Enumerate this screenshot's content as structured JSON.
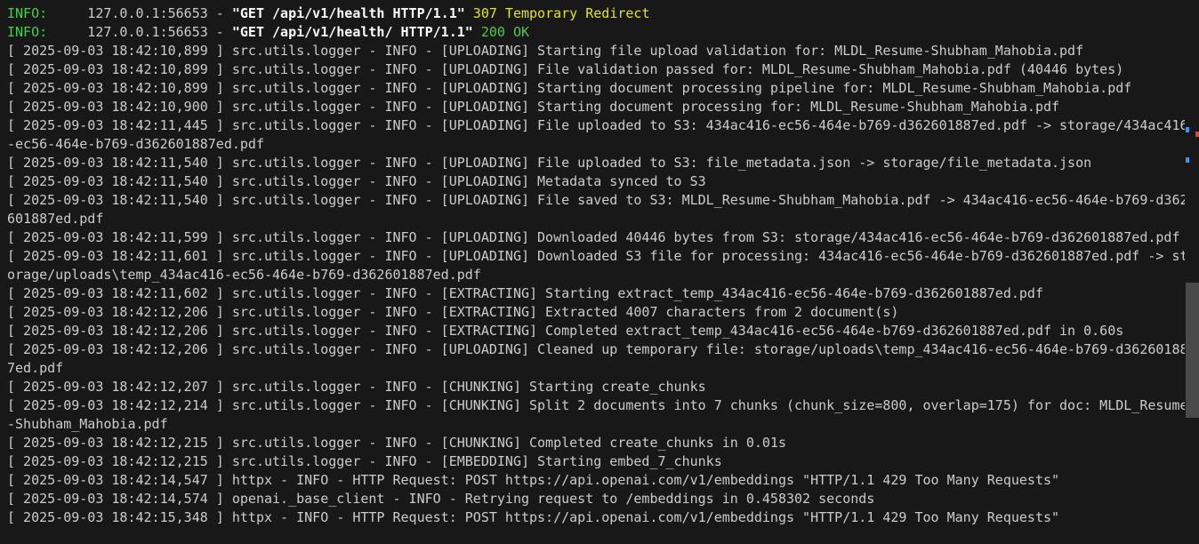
{
  "colors": {
    "background": "#181818",
    "text": "#cccccc",
    "info_green": "#4ec94e",
    "redirect_yellow": "#e5e510",
    "scrollbar_thumb": "#4a4a4a"
  },
  "terminal": {
    "access_lines": [
      {
        "level": "INFO:",
        "client": "     127.0.0.1:56653 - ",
        "request": "\"GET /api/v1/health HTTP/1.1\"",
        "status": " 307 Temporary Redirect"
      },
      {
        "level": "INFO:",
        "client": "     127.0.0.1:56653 - ",
        "request": "\"GET /api/v1/health/ HTTP/1.1\"",
        "status": " 200 OK"
      }
    ],
    "log_lines": [
      "[ 2025-09-03 18:42:10,899 ] src.utils.logger - INFO - [UPLOADING] Starting file upload validation for: MLDL_Resume-Shubham_Mahobia.pdf",
      "[ 2025-09-03 18:42:10,899 ] src.utils.logger - INFO - [UPLOADING] File validation passed for: MLDL_Resume-Shubham_Mahobia.pdf (40446 bytes)",
      "[ 2025-09-03 18:42:10,899 ] src.utils.logger - INFO - [UPLOADING] Starting document processing pipeline for: MLDL_Resume-Shubham_Mahobia.pdf",
      "[ 2025-09-03 18:42:10,900 ] src.utils.logger - INFO - [UPLOADING] Starting document processing for: MLDL_Resume-Shubham_Mahobia.pdf",
      "[ 2025-09-03 18:42:11,445 ] src.utils.logger - INFO - [UPLOADING] File uploaded to S3: 434ac416-ec56-464e-b769-d362601887ed.pdf -> storage/434ac416",
      "-ec56-464e-b769-d362601887ed.pdf",
      "[ 2025-09-03 18:42:11,540 ] src.utils.logger - INFO - [UPLOADING] File uploaded to S3: file_metadata.json -> storage/file_metadata.json",
      "[ 2025-09-03 18:42:11,540 ] src.utils.logger - INFO - [UPLOADING] Metadata synced to S3",
      "[ 2025-09-03 18:42:11,540 ] src.utils.logger - INFO - [UPLOADING] File saved to S3: MLDL_Resume-Shubham_Mahobia.pdf -> 434ac416-ec56-464e-b769-d362",
      "601887ed.pdf",
      "[ 2025-09-03 18:42:11,599 ] src.utils.logger - INFO - [UPLOADING] Downloaded 40446 bytes from S3: storage/434ac416-ec56-464e-b769-d362601887ed.pdf",
      "[ 2025-09-03 18:42:11,601 ] src.utils.logger - INFO - [UPLOADING] Downloaded S3 file for processing: 434ac416-ec56-464e-b769-d362601887ed.pdf -> st",
      "orage/uploads\\temp_434ac416-ec56-464e-b769-d362601887ed.pdf",
      "[ 2025-09-03 18:42:11,602 ] src.utils.logger - INFO - [EXTRACTING] Starting extract_temp_434ac416-ec56-464e-b769-d362601887ed.pdf",
      "[ 2025-09-03 18:42:12,206 ] src.utils.logger - INFO - [EXTRACTING] Extracted 4007 characters from 2 document(s)",
      "[ 2025-09-03 18:42:12,206 ] src.utils.logger - INFO - [EXTRACTING] Completed extract_temp_434ac416-ec56-464e-b769-d362601887ed.pdf in 0.60s",
      "[ 2025-09-03 18:42:12,206 ] src.utils.logger - INFO - [UPLOADING] Cleaned up temporary file: storage/uploads\\temp_434ac416-ec56-464e-b769-d36260188",
      "7ed.pdf",
      "[ 2025-09-03 18:42:12,207 ] src.utils.logger - INFO - [CHUNKING] Starting create_chunks",
      "[ 2025-09-03 18:42:12,214 ] src.utils.logger - INFO - [CHUNKING] Split 2 documents into 7 chunks (chunk_size=800, overlap=175) for doc: MLDL_Resume",
      "-Shubham_Mahobia.pdf",
      "[ 2025-09-03 18:42:12,215 ] src.utils.logger - INFO - [CHUNKING] Completed create_chunks in 0.01s",
      "[ 2025-09-03 18:42:12,215 ] src.utils.logger - INFO - [EMBEDDING] Starting embed_7_chunks",
      "[ 2025-09-03 18:42:14,547 ] httpx - INFO - HTTP Request: POST https://api.openai.com/v1/embeddings \"HTTP/1.1 429 Too Many Requests\"",
      "[ 2025-09-03 18:42:14,574 ] openai._base_client - INFO - Retrying request to /embeddings in 0.458302 seconds",
      "[ 2025-09-03 18:42:15,348 ] httpx - INFO - HTTP Request: POST https://api.openai.com/v1/embeddings \"HTTP/1.1 429 Too Many Requests\""
    ]
  }
}
